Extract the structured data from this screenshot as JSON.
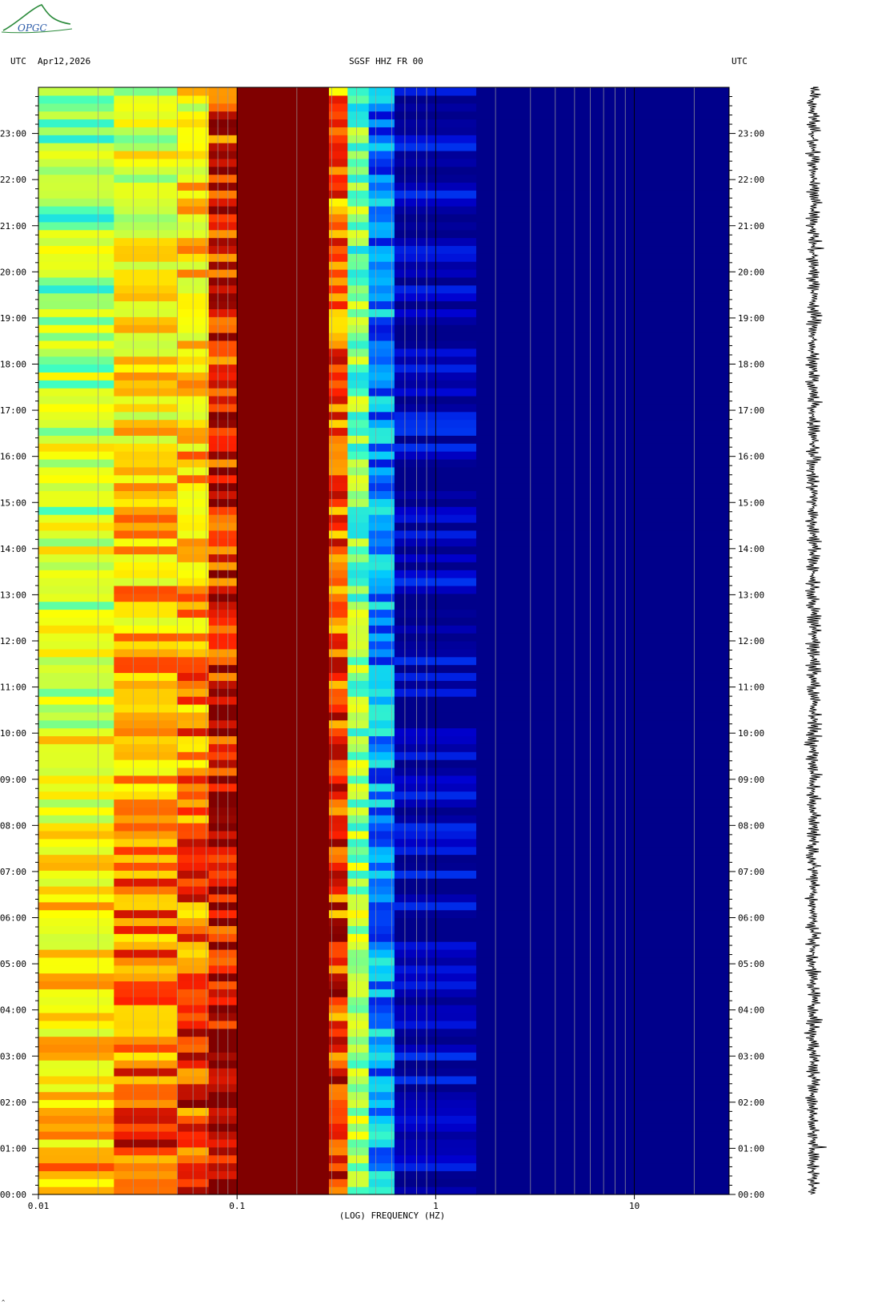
{
  "header": {
    "left_label": "UTC",
    "date": "Apr12,2026",
    "title": "SGSF HHZ FR 00",
    "right_label": "UTC"
  },
  "logo_text": "OPGC",
  "chart_data": {
    "type": "heatmap",
    "title": "SGSF HHZ FR 00",
    "xlabel": "(LOG) FREQUENCY (HZ)",
    "ylabel": "UTC",
    "x_scale": "log",
    "xlim": [
      0.01,
      30
    ],
    "x_ticks": [
      {
        "value": 0.01,
        "label": "0.01"
      },
      {
        "value": 0.1,
        "label": "0.1"
      },
      {
        "value": 1,
        "label": "1"
      },
      {
        "value": 10,
        "label": "10"
      }
    ],
    "y_ticks": [
      "00:00",
      "01:00",
      "02:00",
      "03:00",
      "04:00",
      "05:00",
      "06:00",
      "07:00",
      "08:00",
      "09:00",
      "10:00",
      "11:00",
      "12:00",
      "13:00",
      "14:00",
      "15:00",
      "16:00",
      "17:00",
      "18:00",
      "19:00",
      "20:00",
      "21:00",
      "22:00",
      "23:00"
    ],
    "ylim_hours": [
      0,
      24
    ],
    "colormap": [
      "#00008b",
      "#0000d0",
      "#0050ff",
      "#00c8ff",
      "#40ffc0",
      "#c8ff40",
      "#ffff00",
      "#ffa000",
      "#ff2000",
      "#800000"
    ],
    "spectral_bands": [
      {
        "f_min": 0.01,
        "f_max": 0.024,
        "level_at_00h": 0.72,
        "level_at_24h": 0.5
      },
      {
        "f_min": 0.024,
        "f_max": 0.05,
        "level_at_00h": 0.86,
        "level_at_24h": 0.6
      },
      {
        "f_min": 0.05,
        "f_max": 0.072,
        "level_at_00h": 0.88,
        "level_at_24h": 0.66
      },
      {
        "f_min": 0.072,
        "f_max": 0.1,
        "level_at_00h": 0.96,
        "level_at_24h": 0.88
      },
      {
        "f_min": 0.1,
        "f_max": 0.29,
        "level_at_00h": 1.0,
        "level_at_24h": 1.0
      },
      {
        "f_min": 0.29,
        "f_max": 0.36,
        "level_at_00h": 0.88,
        "level_at_24h": 0.8
      },
      {
        "f_min": 0.36,
        "f_max": 0.46,
        "level_at_00h": 0.58,
        "level_at_24h": 0.48
      },
      {
        "f_min": 0.46,
        "f_max": 0.62,
        "level_at_00h": 0.3,
        "level_at_24h": 0.26
      },
      {
        "f_min": 0.62,
        "f_max": 1.6,
        "level_at_00h": 0.06,
        "level_at_24h": 0.05
      },
      {
        "f_min": 1.6,
        "f_max": 30,
        "level_at_00h": 0.0,
        "level_at_24h": 0.0
      }
    ],
    "grid": true,
    "trace": {
      "label": "seismogram trace",
      "position": "right"
    }
  }
}
